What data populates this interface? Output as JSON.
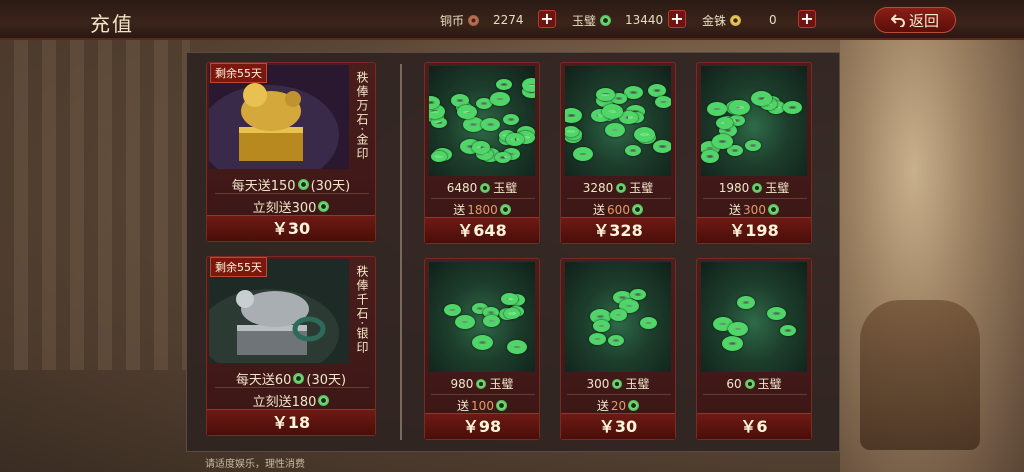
{
  "header": {
    "title": "充值",
    "back_label": "返回"
  },
  "resources": [
    {
      "label": "铜币",
      "value": "2274",
      "icon": "copper-coin-icon",
      "color": "#c0795a"
    },
    {
      "label": "玉璧",
      "value": "13440",
      "icon": "jade-disc-icon",
      "color": "#4fd568"
    },
    {
      "label": "金铢",
      "value": "0",
      "icon": "gold-coin-icon",
      "color": "#f1d46a"
    }
  ],
  "seals": [
    {
      "badge": "剩余55天",
      "vertical_title": "秩俸万石·金印",
      "daily": "每天送150",
      "daily_suffix": "(30天)",
      "instant": "立刻送300",
      "price": "￥30",
      "icon": "gold-seal-icon"
    },
    {
      "badge": "剩余55天",
      "vertical_title": "秩俸千石·银印",
      "daily": "每天送60",
      "daily_suffix": "(30天)",
      "instant": "立刻送180",
      "price": "￥18",
      "icon": "silver-seal-icon"
    }
  ],
  "packs": [
    {
      "amount": "6480",
      "unit": "玉璧",
      "gift_prefix": "送",
      "gift": "1800",
      "price": "￥648"
    },
    {
      "amount": "3280",
      "unit": "玉璧",
      "gift_prefix": "送",
      "gift": "600",
      "price": "￥328"
    },
    {
      "amount": "1980",
      "unit": "玉璧",
      "gift_prefix": "送",
      "gift": "300",
      "price": "￥198"
    },
    {
      "amount": "980",
      "unit": "玉璧",
      "gift_prefix": "送",
      "gift": "100",
      "price": "￥98"
    },
    {
      "amount": "300",
      "unit": "玉璧",
      "gift_prefix": "送",
      "gift": "20",
      "price": "￥30"
    },
    {
      "amount": "60",
      "unit": "玉璧",
      "gift_prefix": "",
      "gift": "",
      "price": "￥6"
    }
  ],
  "footer": {
    "notice": "请适度娱乐，理性消费"
  }
}
